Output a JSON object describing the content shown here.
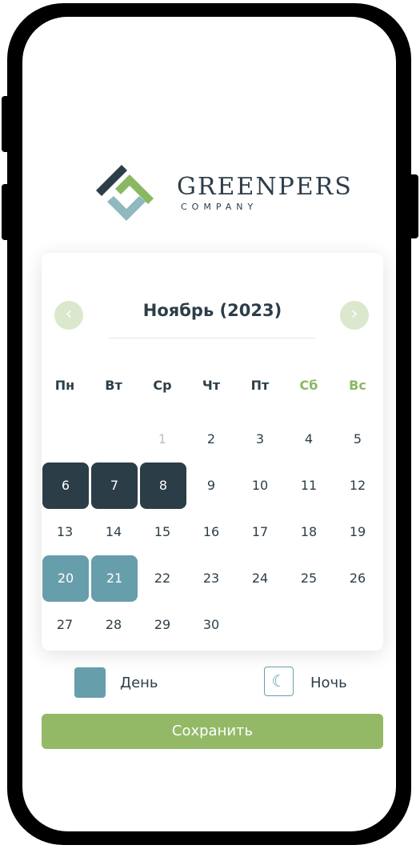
{
  "brand": {
    "name": "GREENPERS",
    "sub": "COMPANY"
  },
  "calendar": {
    "title": "Ноябрь (2023)",
    "prev_icon": "‹",
    "next_icon": "›",
    "weekdays": [
      "Пн",
      "Вт",
      "Ср",
      "Чт",
      "Пт",
      "Сб",
      "Вс"
    ],
    "days": {
      "d1": "1",
      "d2": "2",
      "d3": "3",
      "d4": "4",
      "d5": "5",
      "d6": "6",
      "d7": "7",
      "d8": "8",
      "d9": "9",
      "d10": "10",
      "d11": "11",
      "d12": "12",
      "d13": "13",
      "d14": "14",
      "d15": "15",
      "d16": "16",
      "d17": "17",
      "d18": "18",
      "d19": "19",
      "d20": "20",
      "d21": "21",
      "d22": "22",
      "d23": "23",
      "d24": "24",
      "d25": "25",
      "d26": "26",
      "d27": "27",
      "d28": "28",
      "d29": "29",
      "d30": "30"
    }
  },
  "legend": {
    "day": "День",
    "night": "Ночь",
    "night_icon": "☾"
  },
  "save_label": "Сохранить",
  "colors": {
    "dark": "#2b3d47",
    "teal": "#679eab",
    "green": "#93b966",
    "weekend": "#8ab862"
  }
}
